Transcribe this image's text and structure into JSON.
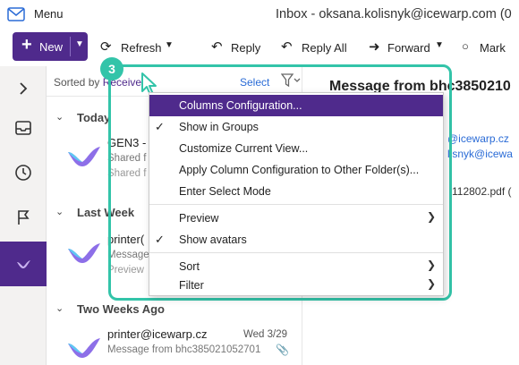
{
  "window": {
    "menu_label": "Menu",
    "title": "Inbox - oksana.kolisnyk@icewarp.com (0"
  },
  "toolbar": {
    "new_label": "New",
    "refresh_label": "Refresh",
    "reply_label": "Reply",
    "reply_all_label": "Reply All",
    "forward_label": "Forward",
    "mark_label": "Mark"
  },
  "list": {
    "sort_prefix": "Sorted by",
    "sort_value": "Received",
    "select_label": "Select",
    "groups": [
      {
        "label": "Today"
      },
      {
        "label": "Last Week"
      },
      {
        "label": "Two Weeks Ago"
      }
    ],
    "messages": [
      {
        "sender": "GEN3 -",
        "line2": "Shared f",
        "line3": "Shared f"
      },
      {
        "sender": "printer(",
        "line2": "Message",
        "line3": "Preview"
      },
      {
        "sender": "printer@icewarp.cz",
        "line2": "Message from bhc385021052701",
        "date": "Wed 3/29"
      }
    ]
  },
  "pane": {
    "subject": "Message from bhc3850210",
    "from": "@icewarp.cz",
    "to": "lisnyk@icewa",
    "attachment": "112802.pdf ("
  },
  "step": {
    "number": "3"
  },
  "context_menu": {
    "items": [
      {
        "label": "Columns Configuration...",
        "highlighted": true
      },
      {
        "label": "Show in Groups",
        "checked": true
      },
      {
        "label": "Customize Current View..."
      },
      {
        "label": "Apply Column Configuration to Other Folder(s)..."
      },
      {
        "label": "Enter Select Mode"
      },
      {
        "label": "Preview",
        "submenu": true
      },
      {
        "label": "Show avatars",
        "checked": true
      },
      {
        "label": "Sort",
        "submenu": true
      },
      {
        "label": "Filter",
        "submenu": true
      }
    ]
  },
  "colors": {
    "accent": "#4f2a8c",
    "highlight_frame": "#33c4a9",
    "link": "#2a6bd6"
  }
}
